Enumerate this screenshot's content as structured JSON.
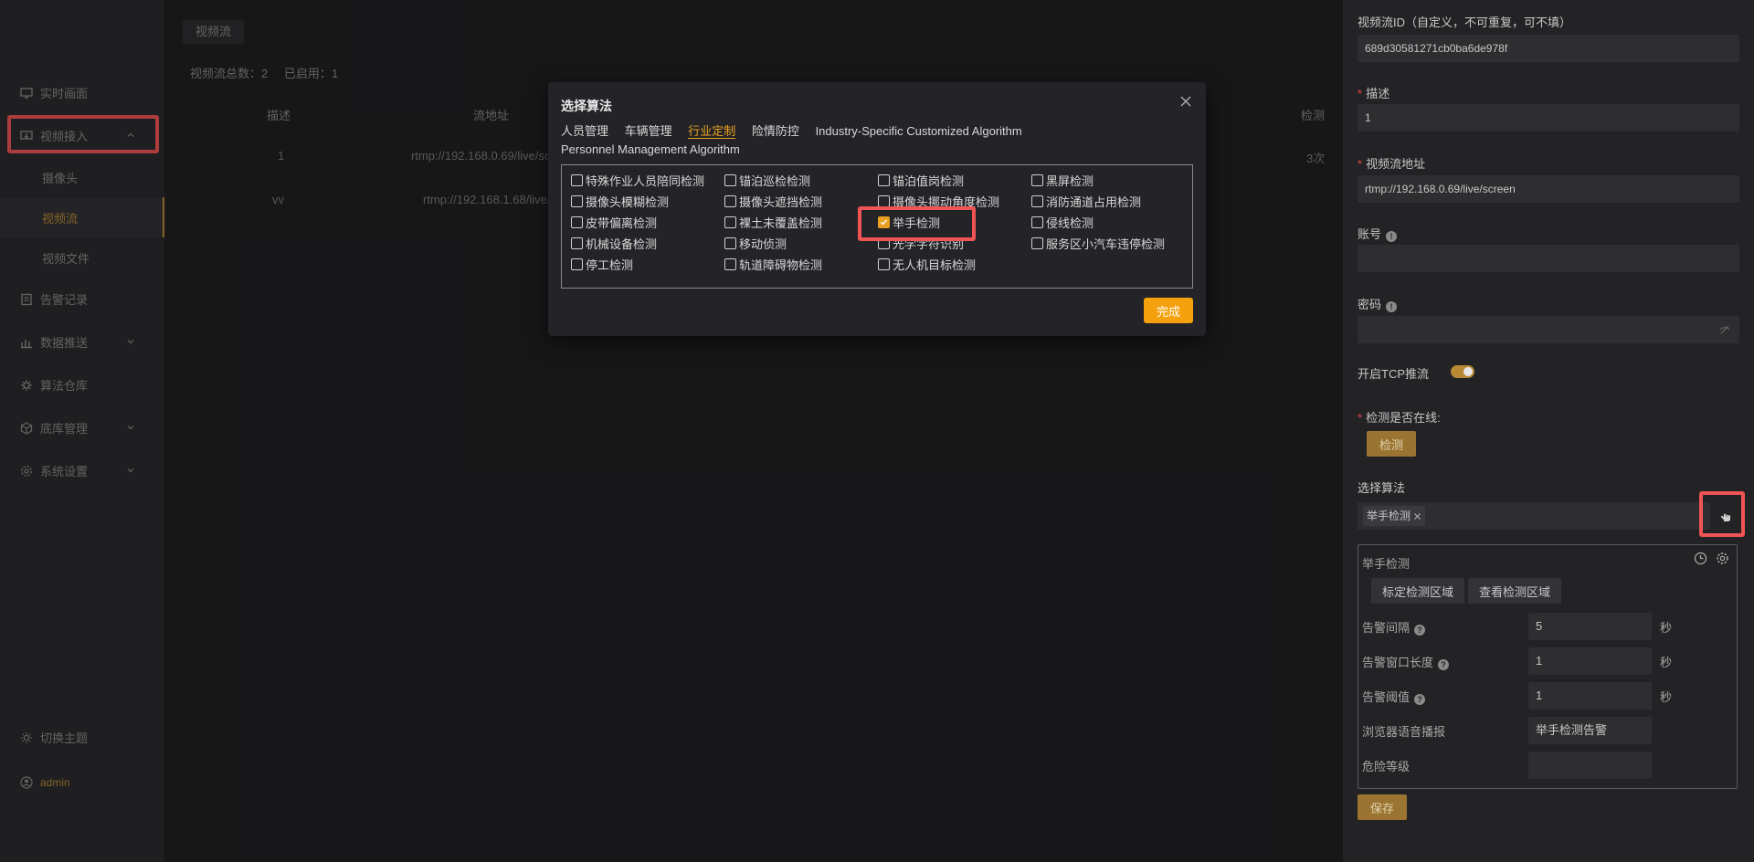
{
  "sidebar": {
    "items": [
      {
        "label": "实时画面",
        "icon": "monitor-icon"
      },
      {
        "label": "视频接入",
        "icon": "video-input-icon"
      },
      {
        "label": "摄像头"
      },
      {
        "label": "视频流"
      },
      {
        "label": "视频文件"
      },
      {
        "label": "告警记录",
        "icon": "alarm-record-icon"
      },
      {
        "label": "数据推送",
        "icon": "data-push-icon"
      },
      {
        "label": "算法仓库",
        "icon": "algorithm-store-icon"
      },
      {
        "label": "底库管理",
        "icon": "base-library-icon"
      },
      {
        "label": "系统设置",
        "icon": "settings-icon"
      }
    ],
    "theme_label": "切换主题",
    "user_label": "admin"
  },
  "main": {
    "tab_label": "视频流",
    "stats_total": "视频流总数：2",
    "stats_enabled": "已启用：1",
    "columns": [
      "描述",
      "流地址",
      "检测"
    ],
    "rows": [
      {
        "desc": "1",
        "url": "rtmp://192.168.0.69/live/sc",
        "detect": "3次"
      },
      {
        "desc": "vv",
        "url": "rtmp://192.168.1.68/live/",
        "detect": ""
      }
    ]
  },
  "dialog": {
    "title": "选择算法",
    "tabs": [
      "人员管理",
      "车辆管理",
      "行业定制",
      "险情防控",
      "Industry-Specific Customized Algorithm",
      "Personnel Management Algorithm"
    ],
    "active_tab_index": 2,
    "algorithms": [
      {
        "label": "特殊作业人员陪同检测",
        "checked": false
      },
      {
        "label": "锚泊巡检检测",
        "checked": false
      },
      {
        "label": "锚泊值岗检测",
        "checked": false
      },
      {
        "label": "黑屏检测",
        "checked": false
      },
      {
        "label": "摄像头模糊检测",
        "checked": false
      },
      {
        "label": "摄像头遮挡检测",
        "checked": false
      },
      {
        "label": "摄像头挪动角度检测",
        "checked": false
      },
      {
        "label": "消防通道占用检测",
        "checked": false
      },
      {
        "label": "皮带偏离检测",
        "checked": false
      },
      {
        "label": "裸土未覆盖检测",
        "checked": false
      },
      {
        "label": "举手检测",
        "checked": true
      },
      {
        "label": "侵线检测",
        "checked": false
      },
      {
        "label": "机械设备检测",
        "checked": false
      },
      {
        "label": "移动侦测",
        "checked": false
      },
      {
        "label": "光学字符识别",
        "checked": false
      },
      {
        "label": "服务区小汽车违停检测",
        "checked": false
      },
      {
        "label": "停工检测",
        "checked": false
      },
      {
        "label": "轨道障碍物检测",
        "checked": false
      },
      {
        "label": "无人机目标检测",
        "checked": false
      }
    ],
    "done_label": "完成"
  },
  "panel": {
    "stream_id_label": "视频流ID（自定义，不可重复，可不填）",
    "stream_id_value": "689d30581271cb0ba6de978f",
    "desc_label": "描述",
    "desc_value": "1",
    "url_label": "视频流地址",
    "url_value": "rtmp://192.168.0.69/live/screen",
    "account_label": "账号",
    "password_label": "密码",
    "tcp_label": "开启TCP推流",
    "tcp_enabled": true,
    "online_label": "检测是否在线:",
    "check_label": "检测",
    "algo_label": "选择算法",
    "selected_tag": "举手检测",
    "card": {
      "title": "举手检测",
      "calibrate_label": "标定检测区域",
      "view_label": "查看检测区域",
      "interval_label": "告警间隔",
      "interval_value": "5",
      "window_label": "告警窗口长度",
      "window_value": "1",
      "threshold_label": "告警阈值",
      "threshold_value": "1",
      "voice_label": "浏览器语音播报",
      "voice_value": "举手检测告警",
      "danger_label": "危险等级",
      "danger_value": "",
      "unit": "秒"
    },
    "save_label": "保存"
  },
  "colors": {
    "accent": "#e8a020",
    "highlight": "#f05454",
    "gold_button": "#9a7430"
  }
}
